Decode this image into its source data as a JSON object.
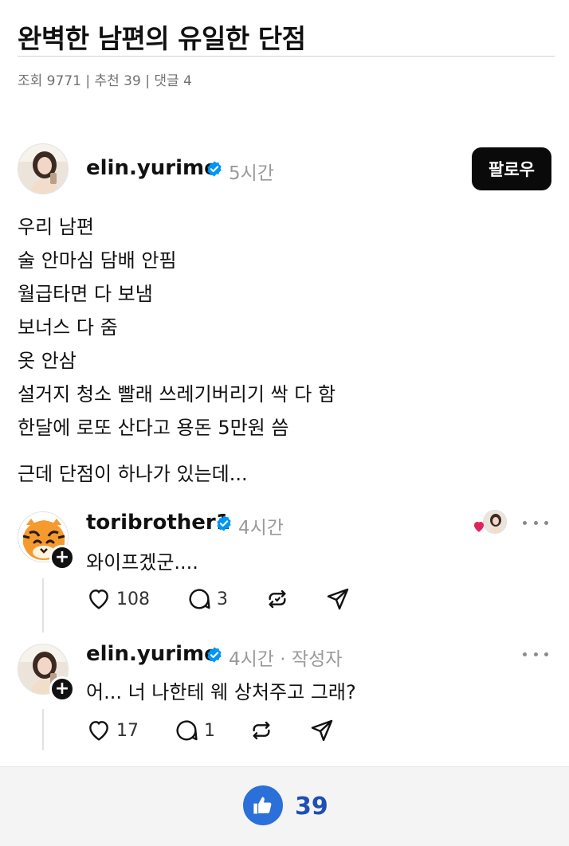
{
  "article": {
    "title": "완벽한 남편의 유일한 단점",
    "meta": "조회 9771 | 추천 39 | 댓글 4"
  },
  "post": {
    "username": "elin.yurime",
    "time": "5시간",
    "follow_label": "팔로우",
    "lines": [
      "우리 남편",
      "술 안마심 담배 안핌",
      "월급타면 다 보냄",
      "보너스 다 줌",
      "옷 안삼",
      "설거지 청소 빨래 쓰레기버리기 싹 다 함",
      "한달에 로또 산다고 용돈 5만원 씀",
      "근데 단점이 하나가 있는데..."
    ]
  },
  "comments": [
    {
      "username": "toribrother1",
      "time": "4시간",
      "author_tag": "",
      "text": "와이프겠군....",
      "likes": "108",
      "replies": "3"
    },
    {
      "username": "elin.yurime",
      "time": "4시간",
      "author_tag": "· 작성자",
      "text": "어... 너 나한테 웨 상처주고 그래?",
      "likes": "17",
      "replies": "1"
    }
  ],
  "recommend": {
    "count": "39"
  },
  "icons": {
    "verified": "verified-badge-icon",
    "like": "heart-icon",
    "reply": "comment-bubble-icon",
    "repost": "repost-icon",
    "share": "send-icon",
    "more": "more-dots-icon",
    "thumbs_up": "thumbs-up-icon"
  },
  "colors": {
    "verified": "#0095f6",
    "follow_bg": "#0a0a0a",
    "thumbs_bg": "#2b6fd8",
    "recommend_count": "#1f4fb3",
    "heart": "#e0245e"
  }
}
